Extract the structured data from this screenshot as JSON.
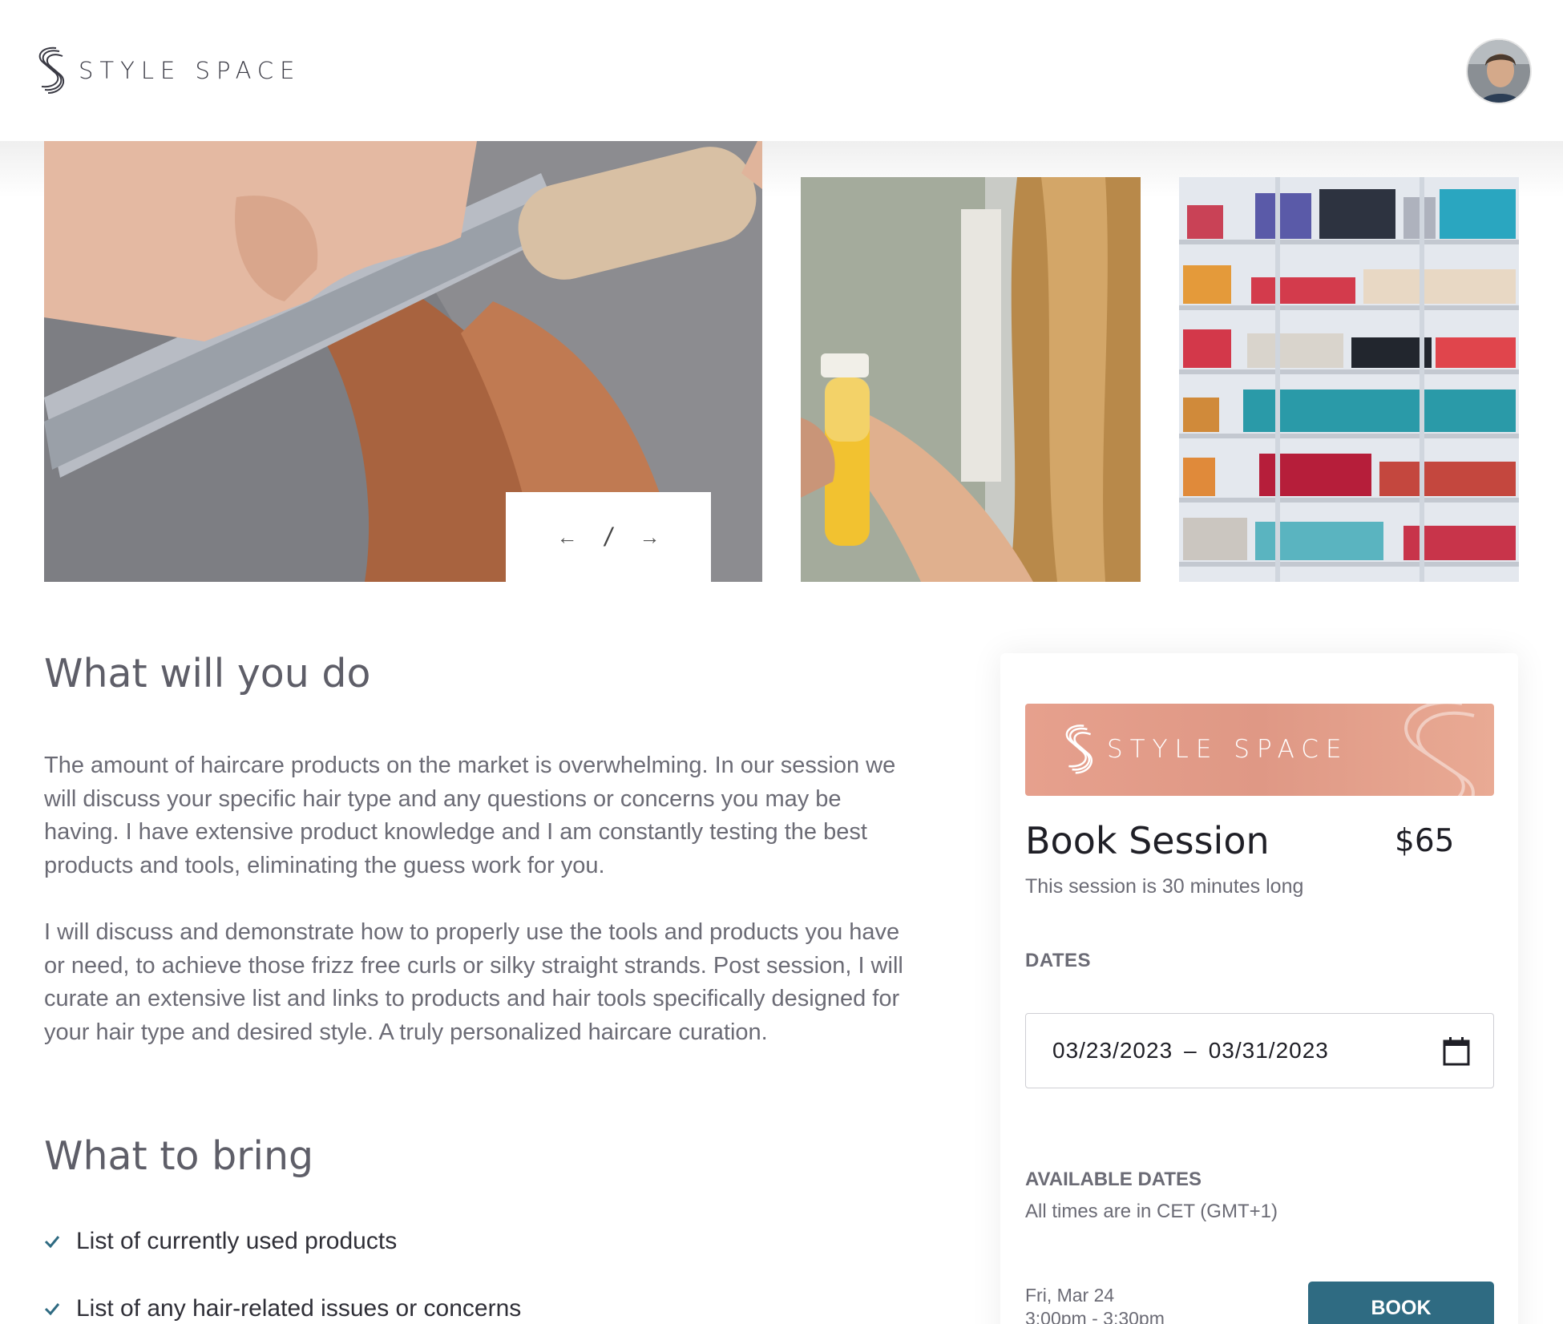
{
  "header": {
    "brand": "STYLE SPACE",
    "logo_icon": "style-space-s-icon",
    "avatar_icon": "user-avatar"
  },
  "gallery": {
    "prev_icon": "arrow-left-icon",
    "next_icon": "arrow-right-icon",
    "separator": "/"
  },
  "content": {
    "heading_do": "What will you do",
    "paragraph1": "The amount of haircare products on the market is overwhelming. In our session we will discuss your specific hair type and any questions or concerns you may be having. I have extensive product knowledge and I am constantly testing the best products and tools, eliminating the guess work for you.",
    "paragraph2": "I will discuss and demonstrate how to properly use the tools and products you have or need, to achieve those frizz free curls or silky straight strands. Post session, I will curate an extensive list and links to products and hair tools specifically designed for your hair type and desired style. A truly personalized haircare curation.",
    "heading_bring": "What to bring",
    "bring_items": [
      "List of currently used products",
      "List of any hair-related issues or concerns"
    ]
  },
  "booking": {
    "banner_brand": "STYLE SPACE",
    "title": "Book Session",
    "price": "$65",
    "duration": "This session is 30 minutes long",
    "dates_label": "DATES",
    "date_start": "03/23/2023",
    "date_separator": "–",
    "date_end": "03/31/2023",
    "calendar_icon": "calendar-icon",
    "available_label": "AVAILABLE DATES",
    "timezone": "All times are in CET (GMT+1)",
    "slot_date": "Fri, Mar 24",
    "slot_time": "3:00pm - 3:30pm",
    "book_button": "BOOK"
  },
  "colors": {
    "accent": "#2f6b82",
    "banner": "#e29d89",
    "check": "#2f6b82"
  }
}
